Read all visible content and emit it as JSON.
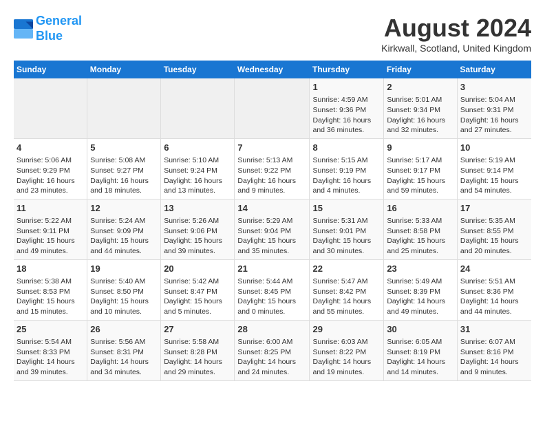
{
  "header": {
    "logo_line1": "General",
    "logo_line2": "Blue",
    "month_year": "August 2024",
    "location": "Kirkwall, Scotland, United Kingdom"
  },
  "weekdays": [
    "Sunday",
    "Monday",
    "Tuesday",
    "Wednesday",
    "Thursday",
    "Friday",
    "Saturday"
  ],
  "weeks": [
    [
      {
        "day": "",
        "info": ""
      },
      {
        "day": "",
        "info": ""
      },
      {
        "day": "",
        "info": ""
      },
      {
        "day": "",
        "info": ""
      },
      {
        "day": "1",
        "info": "Sunrise: 4:59 AM\nSunset: 9:36 PM\nDaylight: 16 hours\nand 36 minutes."
      },
      {
        "day": "2",
        "info": "Sunrise: 5:01 AM\nSunset: 9:34 PM\nDaylight: 16 hours\nand 32 minutes."
      },
      {
        "day": "3",
        "info": "Sunrise: 5:04 AM\nSunset: 9:31 PM\nDaylight: 16 hours\nand 27 minutes."
      }
    ],
    [
      {
        "day": "4",
        "info": "Sunrise: 5:06 AM\nSunset: 9:29 PM\nDaylight: 16 hours\nand 23 minutes."
      },
      {
        "day": "5",
        "info": "Sunrise: 5:08 AM\nSunset: 9:27 PM\nDaylight: 16 hours\nand 18 minutes."
      },
      {
        "day": "6",
        "info": "Sunrise: 5:10 AM\nSunset: 9:24 PM\nDaylight: 16 hours\nand 13 minutes."
      },
      {
        "day": "7",
        "info": "Sunrise: 5:13 AM\nSunset: 9:22 PM\nDaylight: 16 hours\nand 9 minutes."
      },
      {
        "day": "8",
        "info": "Sunrise: 5:15 AM\nSunset: 9:19 PM\nDaylight: 16 hours\nand 4 minutes."
      },
      {
        "day": "9",
        "info": "Sunrise: 5:17 AM\nSunset: 9:17 PM\nDaylight: 15 hours\nand 59 minutes."
      },
      {
        "day": "10",
        "info": "Sunrise: 5:19 AM\nSunset: 9:14 PM\nDaylight: 15 hours\nand 54 minutes."
      }
    ],
    [
      {
        "day": "11",
        "info": "Sunrise: 5:22 AM\nSunset: 9:11 PM\nDaylight: 15 hours\nand 49 minutes."
      },
      {
        "day": "12",
        "info": "Sunrise: 5:24 AM\nSunset: 9:09 PM\nDaylight: 15 hours\nand 44 minutes."
      },
      {
        "day": "13",
        "info": "Sunrise: 5:26 AM\nSunset: 9:06 PM\nDaylight: 15 hours\nand 39 minutes."
      },
      {
        "day": "14",
        "info": "Sunrise: 5:29 AM\nSunset: 9:04 PM\nDaylight: 15 hours\nand 35 minutes."
      },
      {
        "day": "15",
        "info": "Sunrise: 5:31 AM\nSunset: 9:01 PM\nDaylight: 15 hours\nand 30 minutes."
      },
      {
        "day": "16",
        "info": "Sunrise: 5:33 AM\nSunset: 8:58 PM\nDaylight: 15 hours\nand 25 minutes."
      },
      {
        "day": "17",
        "info": "Sunrise: 5:35 AM\nSunset: 8:55 PM\nDaylight: 15 hours\nand 20 minutes."
      }
    ],
    [
      {
        "day": "18",
        "info": "Sunrise: 5:38 AM\nSunset: 8:53 PM\nDaylight: 15 hours\nand 15 minutes."
      },
      {
        "day": "19",
        "info": "Sunrise: 5:40 AM\nSunset: 8:50 PM\nDaylight: 15 hours\nand 10 minutes."
      },
      {
        "day": "20",
        "info": "Sunrise: 5:42 AM\nSunset: 8:47 PM\nDaylight: 15 hours\nand 5 minutes."
      },
      {
        "day": "21",
        "info": "Sunrise: 5:44 AM\nSunset: 8:45 PM\nDaylight: 15 hours\nand 0 minutes."
      },
      {
        "day": "22",
        "info": "Sunrise: 5:47 AM\nSunset: 8:42 PM\nDaylight: 14 hours\nand 55 minutes."
      },
      {
        "day": "23",
        "info": "Sunrise: 5:49 AM\nSunset: 8:39 PM\nDaylight: 14 hours\nand 49 minutes."
      },
      {
        "day": "24",
        "info": "Sunrise: 5:51 AM\nSunset: 8:36 PM\nDaylight: 14 hours\nand 44 minutes."
      }
    ],
    [
      {
        "day": "25",
        "info": "Sunrise: 5:54 AM\nSunset: 8:33 PM\nDaylight: 14 hours\nand 39 minutes."
      },
      {
        "day": "26",
        "info": "Sunrise: 5:56 AM\nSunset: 8:31 PM\nDaylight: 14 hours\nand 34 minutes."
      },
      {
        "day": "27",
        "info": "Sunrise: 5:58 AM\nSunset: 8:28 PM\nDaylight: 14 hours\nand 29 minutes."
      },
      {
        "day": "28",
        "info": "Sunrise: 6:00 AM\nSunset: 8:25 PM\nDaylight: 14 hours\nand 24 minutes."
      },
      {
        "day": "29",
        "info": "Sunrise: 6:03 AM\nSunset: 8:22 PM\nDaylight: 14 hours\nand 19 minutes."
      },
      {
        "day": "30",
        "info": "Sunrise: 6:05 AM\nSunset: 8:19 PM\nDaylight: 14 hours\nand 14 minutes."
      },
      {
        "day": "31",
        "info": "Sunrise: 6:07 AM\nSunset: 8:16 PM\nDaylight: 14 hours\nand 9 minutes."
      }
    ]
  ]
}
